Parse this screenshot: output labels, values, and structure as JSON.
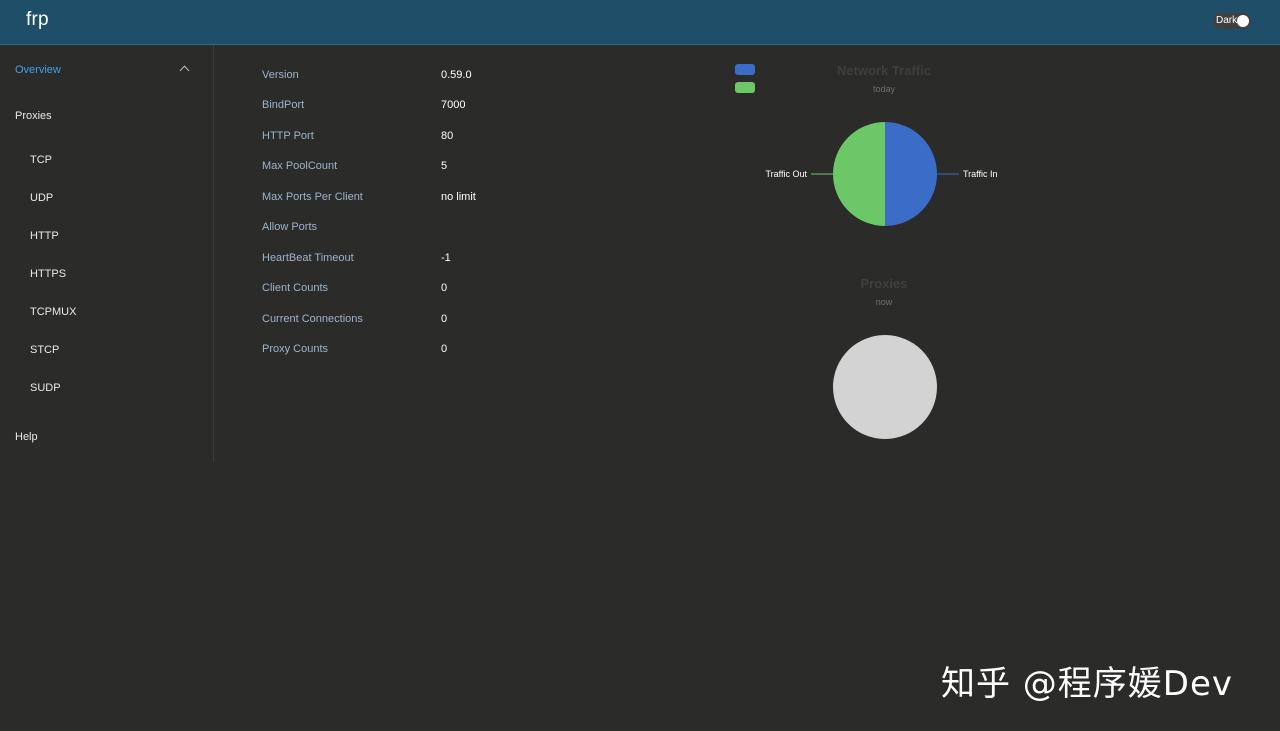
{
  "app": {
    "title": "frp",
    "theme_toggle_label": "Dark"
  },
  "sidebar": {
    "overview": "Overview",
    "proxies": "Proxies",
    "proxy_types": [
      "TCP",
      "UDP",
      "HTTP",
      "HTTPS",
      "TCPMUX",
      "STCP",
      "SUDP"
    ],
    "help": "Help"
  },
  "server_info": [
    {
      "label": "Version",
      "value": "0.59.0"
    },
    {
      "label": "BindPort",
      "value": "7000"
    },
    {
      "label": "HTTP Port",
      "value": "80"
    },
    {
      "label": "Max PoolCount",
      "value": "5"
    },
    {
      "label": "Max Ports Per Client",
      "value": "no limit"
    },
    {
      "label": "Allow Ports",
      "value": ""
    },
    {
      "label": "HeartBeat Timeout",
      "value": "-1"
    },
    {
      "label": "Client Counts",
      "value": "0"
    },
    {
      "label": "Current Connections",
      "value": "0"
    },
    {
      "label": "Proxy Counts",
      "value": "0"
    }
  ],
  "colors": {
    "traffic_in": "#3a6cc8",
    "traffic_out": "#6cc866",
    "empty_pie": "#d3d3d3",
    "accent": "#3ea0ef"
  },
  "chart_data": [
    {
      "type": "pie",
      "title": "Network Traffic",
      "subtitle": "today",
      "categories": [
        "Traffic In",
        "Traffic Out"
      ],
      "values": [
        50,
        50
      ],
      "legend": "top-left"
    },
    {
      "type": "pie",
      "title": "Proxies",
      "subtitle": "now",
      "categories": [],
      "values": []
    }
  ],
  "watermark": "知乎 @程序媛Dev"
}
